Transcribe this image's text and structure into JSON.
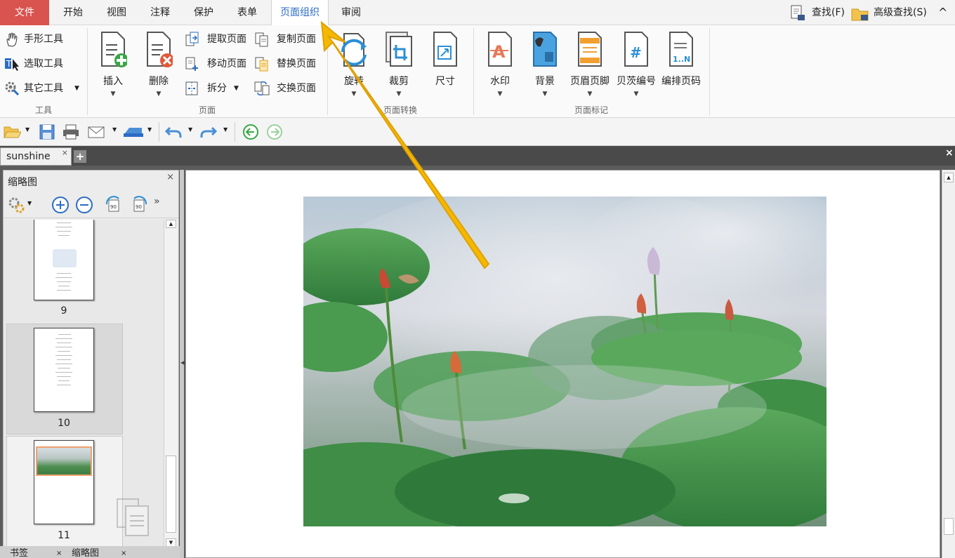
{
  "menu": {
    "tabs": [
      "文件",
      "开始",
      "视图",
      "注释",
      "保护",
      "表单",
      "页面组织",
      "审阅"
    ],
    "active_tab": "页面组织",
    "find_label": "查找(F)",
    "advanced_find_label": "高级查找(S)",
    "collapse_glyph": "^"
  },
  "ribbon": {
    "tools_group": {
      "label": "工具",
      "items": [
        "手形工具",
        "选取工具",
        "其它工具"
      ]
    },
    "page_group": {
      "label": "页面",
      "insert": "插入",
      "delete": "删除",
      "extract": "提取页面",
      "copy": "复制页面",
      "move": "移动页面",
      "replace": "替换页面",
      "split": "拆分",
      "swap": "交换页面"
    },
    "transform_group": {
      "label": "页面转换",
      "rotate": "旋转",
      "crop": "裁剪",
      "size": "尺寸"
    },
    "mark_group": {
      "label": "页面标记",
      "watermark": "水印",
      "background": "背景",
      "header_footer": "页眉页脚",
      "bates": "贝茨编号",
      "page_number": "编排页码",
      "page_number_icon_text": "1..N"
    }
  },
  "document": {
    "tab_name": "sunshine",
    "close_glyph": "×",
    "new_tab_glyph": "+"
  },
  "panel": {
    "title": "缩略图",
    "close_glyph": "×",
    "thumbnails": [
      {
        "page": "9"
      },
      {
        "page": "10"
      },
      {
        "page": "11"
      }
    ],
    "bottom_tabs": [
      "书签",
      "缩略图"
    ]
  },
  "colors": {
    "file_tab": "#d9534f",
    "active_tab_text": "#2b6cc4",
    "annotation_arrow": "#f5b800",
    "selection_border": "#f0a070"
  }
}
